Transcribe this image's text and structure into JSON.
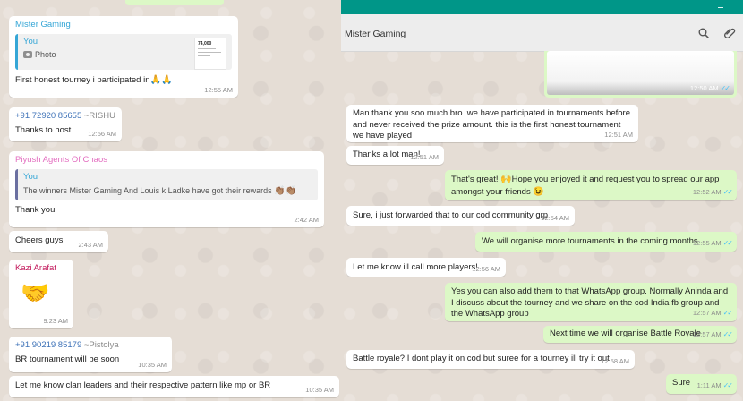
{
  "left": {
    "messages": [
      {
        "sender": "Mister Gaming",
        "sender_color": "#35a6d6",
        "quote_name": "You",
        "quote_name_color": "#35a6d6",
        "quote_text": "Photo",
        "thumb_title": "74,000",
        "text": "First honest tourney i participated in",
        "emoji": "🙏🙏",
        "time": "12:55 AM"
      },
      {
        "sender": "+91 72920 85655",
        "sender_suffix": "~RISHU",
        "sender_color": "#3f73b8",
        "text": "Thanks to host",
        "time": "12:56 AM"
      },
      {
        "sender": "Piyush Agents Of Chaos",
        "sender_color": "#e36fc0",
        "quote_name": "You",
        "quote_name_color": "#35a6d6",
        "quote_text": "The winners Mister Gaming And Louis k Ladke have got their rewards",
        "quote_emoji": "👏🏽👏🏽",
        "text": "Thank you",
        "time": "2:42 AM"
      },
      {
        "text": "Cheers guys",
        "time": "2:43 AM"
      },
      {
        "sender": "Kazi Arafat",
        "sender_color": "#c2185b",
        "emoji": "🤝",
        "time": "9:23 AM"
      },
      {
        "sender": "+91 90219 85179",
        "sender_suffix": "~Pistolya",
        "sender_color": "#3f73b8",
        "text": "BR tournament will be soon",
        "time": "10:35 AM"
      },
      {
        "text": "Let me know clan leaders and their respective pattern like mp or BR",
        "time": "10:35 AM"
      }
    ]
  },
  "right": {
    "header": {
      "title": "Mister Gaming",
      "search_icon": "search-icon",
      "attach_icon": "paperclip-icon"
    },
    "media_time": "12:50 AM",
    "messages": [
      {
        "dir": "in",
        "text": "Man thank you soo much bro. we have participated in tournaments before and never received the prize amount. this is the first honest tournament we have played",
        "time": "12:51 AM"
      },
      {
        "dir": "in",
        "text": "Thanks a lot man!",
        "time": "12:51 AM"
      },
      {
        "dir": "out",
        "text_a": "That's great!",
        "emoji_a": "🙌",
        "text_b": "Hope you enjoyed it and request you to spread our app amongst your friends",
        "emoji_b": "😉",
        "time": "12:52 AM"
      },
      {
        "dir": "in",
        "text": "Sure, i just forwarded that to our cod community grp",
        "time": "12:54 AM"
      },
      {
        "dir": "out",
        "text": "We will organise more tournaments in the coming months",
        "time": "12:55 AM"
      },
      {
        "dir": "in",
        "text": "Let me know ill call more players!",
        "time": "12:56 AM"
      },
      {
        "dir": "out",
        "text": "Yes you can also add them to that WhatsApp group. Normally Aninda and I discuss about the tourney and we share on the cod India fb group and the WhatsApp group",
        "time": "12:57 AM"
      },
      {
        "dir": "out",
        "text": "Next time we will organise Battle Royale",
        "time": "12:57 AM"
      },
      {
        "dir": "in",
        "text": "Battle royale? I dont play it on cod but suree for a tourney ill try it out",
        "time": "12:58 AM"
      },
      {
        "dir": "out",
        "text": "Sure",
        "time": "1:11 AM"
      }
    ]
  },
  "colors": {
    "outgoing_bubble": "#dcf8c6",
    "incoming_bubble": "#ffffff",
    "wallpaper": "#e5ddd5",
    "read_ticks": "#4fc3f7",
    "titlebar": "#009688"
  }
}
